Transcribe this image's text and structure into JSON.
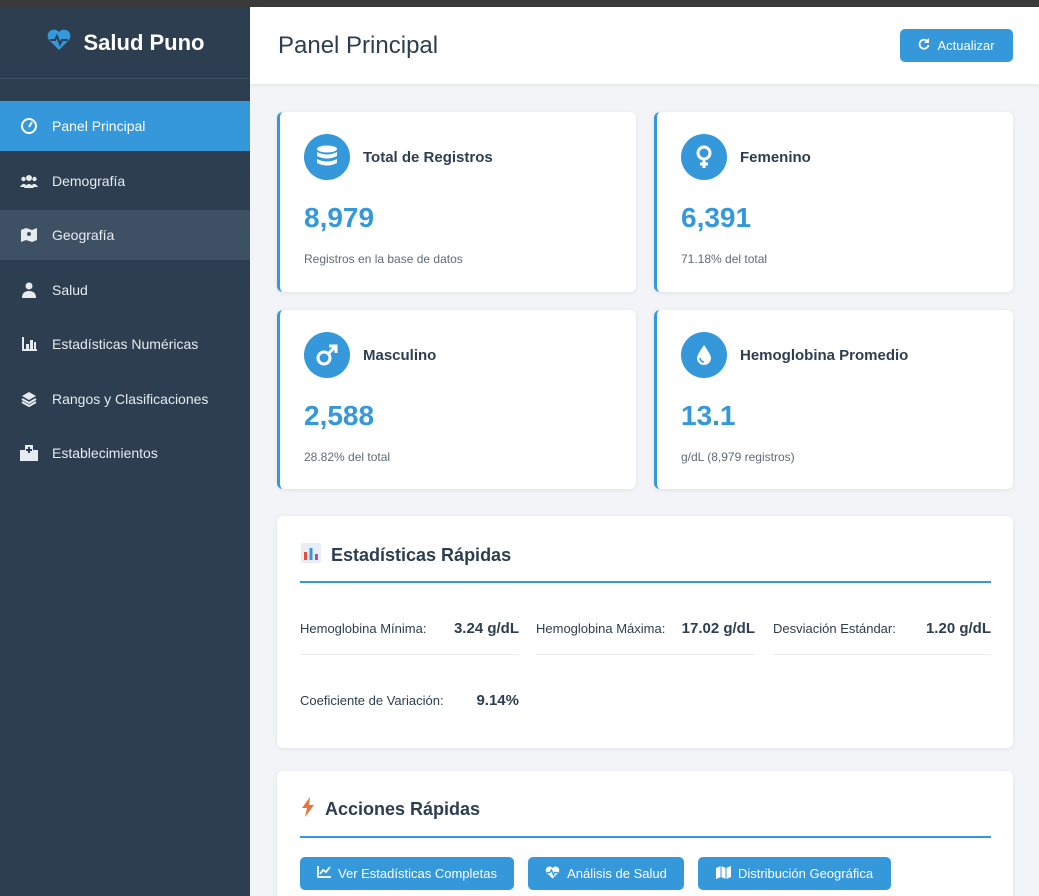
{
  "sidebar": {
    "brand": "Salud Puno",
    "brand_icon": "heartbeat-icon",
    "items": [
      {
        "label": "Panel Principal",
        "icon": "tachometer-icon"
      },
      {
        "label": "Demografía",
        "icon": "users-icon"
      },
      {
        "label": "Geografía",
        "icon": "map-icon"
      },
      {
        "label": "Salud",
        "icon": "user-doctor-icon"
      },
      {
        "label": "Estadísticas Numéricas",
        "icon": "chart-icon"
      },
      {
        "label": "Rangos y Clasificaciones",
        "icon": "layers-icon"
      },
      {
        "label": "Establecimientos",
        "icon": "hospital-icon"
      }
    ]
  },
  "header": {
    "title": "Panel Principal",
    "refresh_label": "Actualizar"
  },
  "cards": [
    {
      "title": "Total de Registros",
      "value": "8,979",
      "sub": "Registros en la base de datos",
      "icon": "database-icon"
    },
    {
      "title": "Femenino",
      "value": "6,391",
      "sub": "71.18% del total",
      "icon": "venus-icon"
    },
    {
      "title": "Masculino",
      "value": "2,588",
      "sub": "28.82% del total",
      "icon": "mars-icon"
    },
    {
      "title": "Hemoglobina Promedio",
      "value": "13.1",
      "sub": "g/dL (8,979 registros)",
      "icon": "droplet-icon"
    }
  ],
  "quick_stats": {
    "title": "Estadísticas Rápidas",
    "items": [
      {
        "label": "Hemoglobina Mínima:",
        "value": "3.24 g/dL"
      },
      {
        "label": "Hemoglobina Máxima:",
        "value": "17.02 g/dL"
      },
      {
        "label": "Desviación Estándar:",
        "value": "1.20 g/dL"
      },
      {
        "label": "Coeficiente de Variación:",
        "value": "9.14%"
      }
    ]
  },
  "quick_actions": {
    "title": "Acciones Rápidas",
    "buttons": [
      {
        "label": "Ver Estadísticas Completas",
        "icon": "line-chart-icon"
      },
      {
        "label": "Análisis de Salud",
        "icon": "heartbeat-icon"
      },
      {
        "label": "Distribución Geográfica",
        "icon": "map-icon"
      }
    ]
  },
  "colors": {
    "accent": "#3498db",
    "sidebar": "#2c3e50",
    "background": "#f2f4f7"
  }
}
